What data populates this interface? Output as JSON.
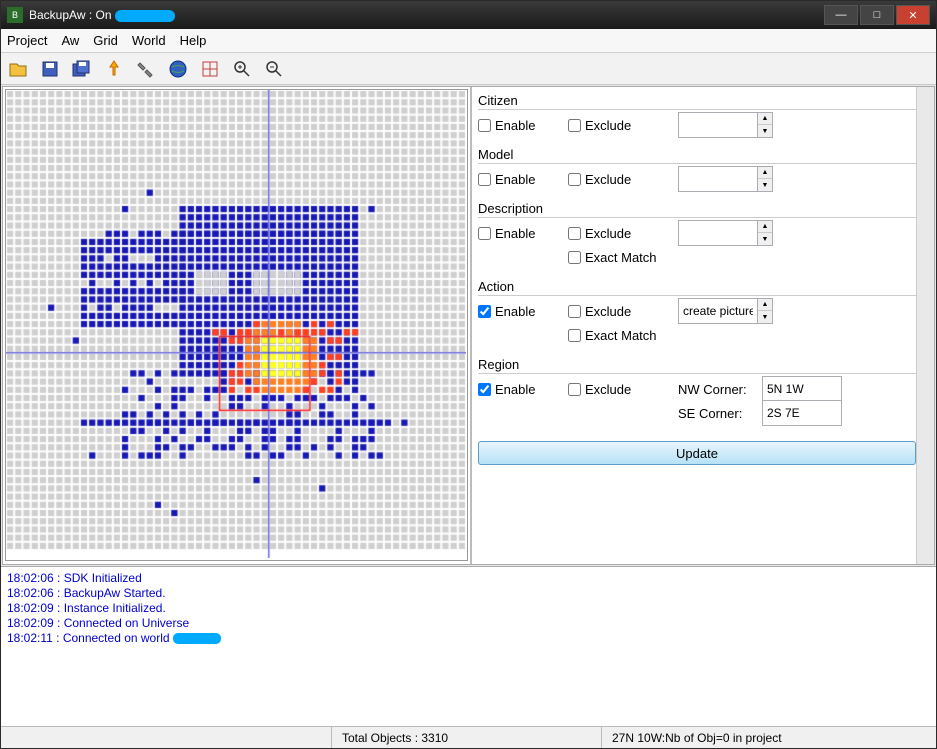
{
  "window": {
    "title_prefix": "BackupAw : On "
  },
  "menu": {
    "project": "Project",
    "aw": "Aw",
    "grid": "Grid",
    "world": "World",
    "help": "Help"
  },
  "toolbar_icons": [
    "open",
    "save",
    "saveall",
    "export",
    "tools",
    "world",
    "map",
    "zoomin",
    "zoomout"
  ],
  "panel": {
    "citizen": {
      "title": "Citizen",
      "enable": "Enable",
      "enable_checked": false,
      "exclude": "Exclude",
      "exclude_checked": false,
      "value": ""
    },
    "model": {
      "title": "Model",
      "enable": "Enable",
      "enable_checked": false,
      "exclude": "Exclude",
      "exclude_checked": false,
      "value": ""
    },
    "description": {
      "title": "Description",
      "enable": "Enable",
      "enable_checked": false,
      "exclude": "Exclude",
      "exclude_checked": false,
      "exact": "Exact Match",
      "exact_checked": false,
      "value": ""
    },
    "action": {
      "title": "Action",
      "enable": "Enable",
      "enable_checked": true,
      "exclude": "Exclude",
      "exclude_checked": false,
      "exact": "Exact Match",
      "exact_checked": false,
      "value": "create picture"
    },
    "region": {
      "title": "Region",
      "enable": "Enable",
      "enable_checked": true,
      "exclude": "Exclude",
      "exclude_checked": false,
      "nw_label": "NW Corner:",
      "nw_value": "5N 1W",
      "se_label": "SE Corner:",
      "se_value": "2S 7E"
    },
    "update": "Update"
  },
  "log": [
    "18:02:06 : SDK Initialized",
    "18:02:06 : BackupAw Started.",
    "18:02:09 : Instance Initialized.",
    "18:02:09 : Connected on Universe",
    "18:02:11 : Connected on world "
  ],
  "status": {
    "total": "Total Objects : 3310",
    "coord": "27N 10W:Nb of Obj=0 in project"
  },
  "chart_data": {
    "type": "heatmap",
    "grid_size": [
      56,
      56
    ],
    "axis_cross": [
      32,
      32
    ],
    "selection_box": {
      "x": 26,
      "y": 30,
      "w": 11,
      "h": 9
    },
    "description": "Object density grid. Blue = low density, red/orange = high density, yellow = peak. Main cluster roughly cols 9..46, rows 12..46 with irregular shape; hotspot near cols 28..38 rows 28..38.",
    "legend": {
      "empty": "#d0d0d0",
      "low": "#1818b6",
      "mid": "#ff4020",
      "high": "#ffff20"
    }
  }
}
